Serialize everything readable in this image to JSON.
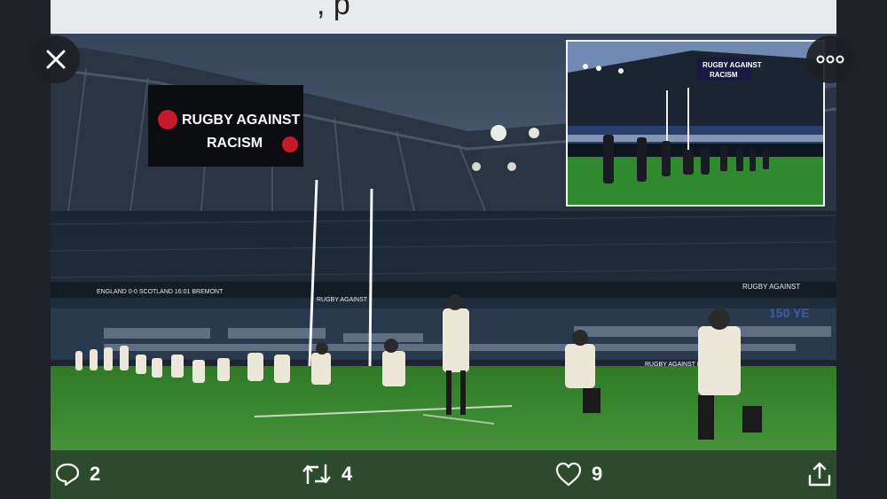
{
  "header": {
    "partial_text": ", p"
  },
  "photo": {
    "alt": "",
    "scoreboard_line1": "RUGBY AGAINST",
    "scoreboard_line2": "RACISM",
    "board_scores": "ENGLAND  0-0  SCOTLAND   16:01  BREMONT",
    "ad_main": "RUGBY AGAINST RACISM",
    "ad_small": "RUGBY AGAINST",
    "ad_150": "150 YE",
    "inset_board_line1": "RUGBY AGAINST",
    "inset_board_line2": "RACISM"
  },
  "actions": {
    "reply_count": "2",
    "retweet_count": "4",
    "like_count": "9"
  },
  "colors": {
    "pitch": "#3f8a2f",
    "sky": "#3f4e66",
    "action_bar": "#2c4a2c"
  }
}
